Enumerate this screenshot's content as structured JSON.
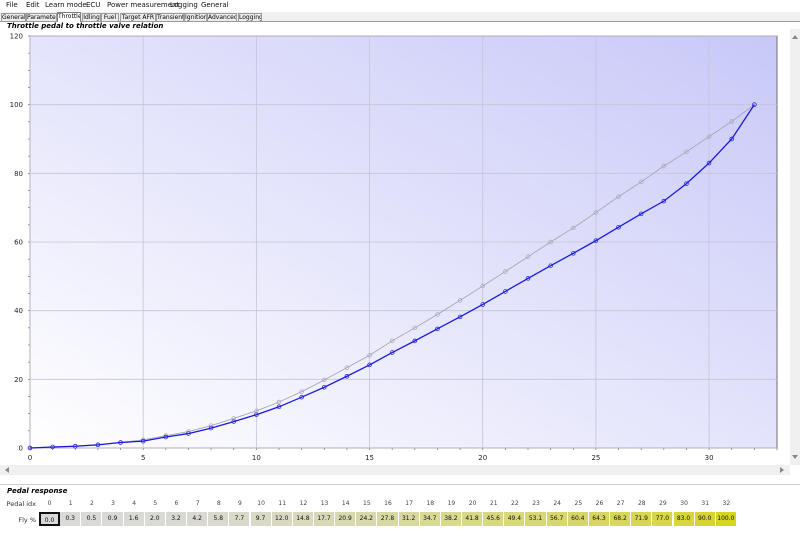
{
  "menu": [
    "File",
    "Edit",
    "Learn mode",
    "ECU",
    "Power measurement",
    "Logging",
    "General"
  ],
  "tabs": [
    {
      "label": "General",
      "active": false
    },
    {
      "label": "Parameters",
      "active": false
    },
    {
      "label": "Throttle",
      "active": true
    },
    {
      "label": "Idling",
      "active": false
    },
    {
      "label": "Fuel",
      "active": false
    },
    {
      "label": "Target AFR",
      "active": false
    },
    {
      "label": "Transient",
      "active": false
    },
    {
      "label": "Ignition",
      "active": false
    },
    {
      "label": "Advanced",
      "active": false
    },
    {
      "label": "Logging",
      "active": false
    }
  ],
  "chart_title": "Throttle pedal to throttle valve relation",
  "chart_data": {
    "type": "line",
    "title": "Throttle pedal to throttle valve relation",
    "xlabel": "",
    "ylabel": "",
    "xlim": [
      0,
      33
    ],
    "ylim": [
      0,
      120
    ],
    "x_ticks": [
      0,
      5,
      10,
      15,
      20,
      25,
      30
    ],
    "y_ticks": [
      0,
      20,
      40,
      60,
      80,
      100,
      120
    ],
    "grid": true,
    "series": [
      {
        "color": "#1a1adc",
        "x": [
          0,
          1,
          2,
          3,
          4,
          5,
          6,
          7,
          8,
          9,
          10,
          11,
          12,
          13,
          14,
          15,
          16,
          17,
          18,
          19,
          20,
          21,
          22,
          23,
          24,
          25,
          26,
          27,
          28,
          29,
          30,
          31,
          32
        ],
        "values": [
          0.0,
          0.3,
          0.5,
          0.9,
          1.6,
          2.0,
          3.2,
          4.2,
          5.8,
          7.7,
          9.7,
          12.0,
          14.8,
          17.7,
          20.9,
          24.2,
          27.8,
          31.2,
          34.7,
          38.2,
          41.8,
          45.6,
          49.4,
          53.1,
          56.7,
          60.4,
          64.3,
          68.2,
          71.9,
          77.0,
          83.0,
          90.0,
          100.0
        ]
      },
      {
        "color": "#a8a8b4",
        "x": [
          0,
          1,
          2,
          3,
          4,
          5,
          6,
          7,
          8,
          9,
          10,
          11,
          12,
          13,
          14,
          15,
          16,
          17,
          18,
          19,
          20,
          21,
          22,
          23,
          24,
          25,
          26,
          27,
          28,
          29,
          30,
          31,
          32
        ],
        "values": [
          0.0,
          0.3,
          0.6,
          1.0,
          1.6,
          2.4,
          3.6,
          4.8,
          6.5,
          8.6,
          10.8,
          13.4,
          16.4,
          19.8,
          23.4,
          27.0,
          31.2,
          35.0,
          38.9,
          43.0,
          47.2,
          51.4,
          55.7,
          60.0,
          64.1,
          68.6,
          73.2,
          77.5,
          82.1,
          86.3,
          90.7,
          95.1,
          100.0
        ]
      }
    ]
  },
  "pedal_response": {
    "title": "Pedal response",
    "idx_label": "Pedal idx",
    "fly_label": "Fly %",
    "indices": [
      "0",
      "1",
      "2",
      "3",
      "4",
      "5",
      "6",
      "7",
      "8",
      "9",
      "10",
      "11",
      "12",
      "13",
      "14",
      "15",
      "16",
      "17",
      "18",
      "19",
      "20",
      "21",
      "22",
      "23",
      "24",
      "25",
      "26",
      "27",
      "28",
      "29",
      "30",
      "31",
      "32"
    ],
    "values": [
      "0.0",
      "0.3",
      "0.5",
      "0.9",
      "1.6",
      "2.0",
      "3.2",
      "4.2",
      "5.8",
      "7.7",
      "9.7",
      "12.0",
      "14.8",
      "17.7",
      "20.9",
      "24.2",
      "27.8",
      "31.2",
      "34.7",
      "38.2",
      "41.8",
      "45.6",
      "49.4",
      "53.1",
      "56.7",
      "60.4",
      "64.3",
      "68.2",
      "71.9",
      "77.0",
      "83.0",
      "90.0",
      "100.0"
    ],
    "numeric": [
      0.0,
      0.3,
      0.5,
      0.9,
      1.6,
      2.0,
      3.2,
      4.2,
      5.8,
      7.7,
      9.7,
      12.0,
      14.8,
      17.7,
      20.9,
      24.2,
      27.8,
      31.2,
      34.7,
      38.2,
      41.8,
      45.6,
      49.4,
      53.1,
      56.7,
      60.4,
      64.3,
      68.2,
      71.9,
      77.0,
      83.0,
      90.0,
      100.0
    ],
    "selected_index": 0,
    "color_low": "#d9d9d9",
    "color_high": "#d6d61c"
  }
}
